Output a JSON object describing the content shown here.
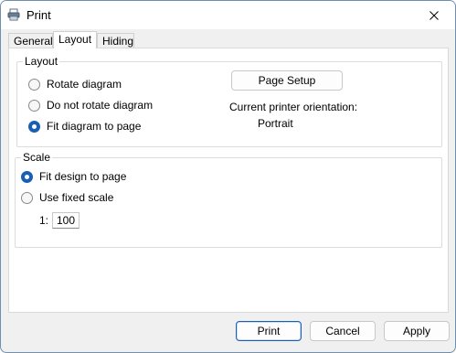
{
  "window": {
    "title": "Print",
    "icon": "printer-icon",
    "close_icon": "close-icon"
  },
  "tabs": [
    {
      "label": "General",
      "active": false
    },
    {
      "label": "Layout",
      "active": true
    },
    {
      "label": "Hiding",
      "active": false
    }
  ],
  "layout_group": {
    "legend": "Layout",
    "options": [
      {
        "label": "Rotate diagram",
        "checked": false
      },
      {
        "label": "Do not rotate diagram",
        "checked": false
      },
      {
        "label": "Fit diagram to page",
        "checked": true
      }
    ],
    "page_setup_button": "Page Setup",
    "orientation_label": "Current printer orientation:",
    "orientation_value": "Portrait"
  },
  "scale_group": {
    "legend": "Scale",
    "options": [
      {
        "label": "Fit design to page",
        "checked": true
      },
      {
        "label": "Use fixed scale",
        "checked": false
      }
    ],
    "scale_prefix": "1:",
    "scale_value": "100"
  },
  "footer": {
    "print_button": "Print",
    "cancel_button": "Cancel",
    "apply_button": "Apply"
  },
  "colors": {
    "accent": "#1a5fb4",
    "window_bg": "#f0f0f0",
    "panel_bg": "#ffffff"
  }
}
